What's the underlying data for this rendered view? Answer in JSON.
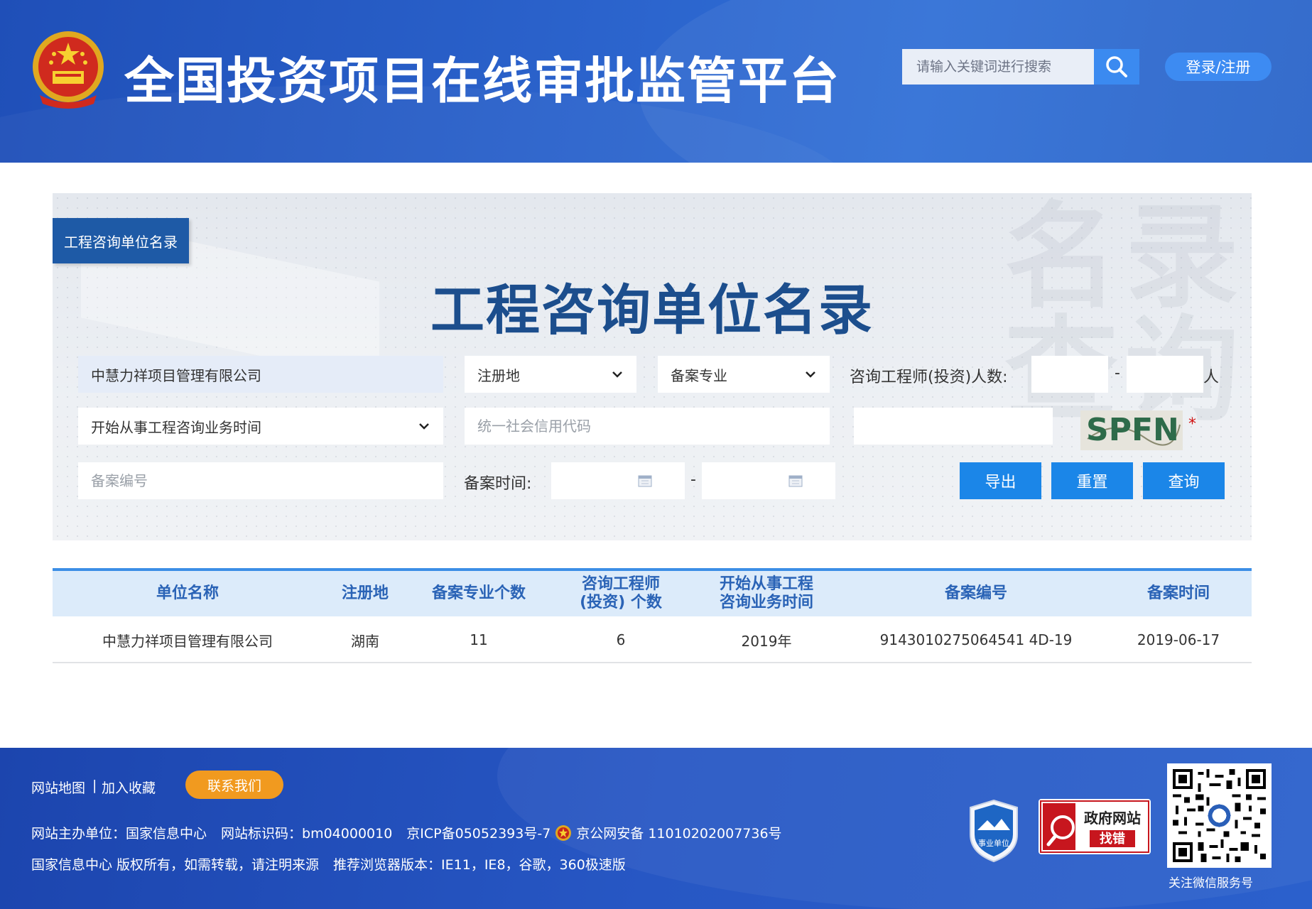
{
  "header": {
    "site_title": "全国投资项目在线审批监管平台",
    "search_placeholder": "请输入关键词进行搜索",
    "login_label": "登录/注册"
  },
  "panel": {
    "tag": "工程咨询单位名录",
    "title": "工程咨询单位名录",
    "watermark_line1": "名录",
    "watermark_line2": "查询",
    "unit_name_value": "中慧力祥项目管理有限公司",
    "region_select": "注册地",
    "specialty_select": "备案专业",
    "engineer_count_label": "咨询工程师(投资)人数:",
    "range_dash": "-",
    "people_unit": "人",
    "start_time_select": "开始从事工程咨询业务时间",
    "credit_code_placeholder": "统一社会信用代码",
    "captcha_text": "SPFN",
    "required_mark": "*",
    "record_no_placeholder": "备案编号",
    "record_time_label": "备案时间:",
    "export_label": "导出",
    "reset_label": "重置",
    "query_label": "查询"
  },
  "table": {
    "headers": [
      "单位名称",
      "注册地",
      "备案专业个数",
      "咨询工程师\n(投资) 个数",
      "开始从事工程\n咨询业务时间",
      "备案编号",
      "备案时间"
    ],
    "rows": [
      [
        "中慧力祥项目管理有限公司",
        "湖南",
        "11",
        "6",
        "2019年",
        "9143010275064541 4D-19",
        "2019-06-17"
      ]
    ]
  },
  "footer": {
    "sitemap": "网站地图",
    "sep": "|",
    "favorite": "加入收藏",
    "contact": "联系我们",
    "sponsor": "网站主办单位：国家信息中心",
    "site_id": "网站标识码：bm04000010",
    "icp": "京ICP备05052393号-7",
    "police": "京公网安备 11010202007736号",
    "copyright": "国家信息中心 版权所有，如需转载，请注明来源",
    "browser": "推荐浏览器版本：IE11，IE8，谷歌，360极速版",
    "badge_label": "事业单位",
    "gov_top": "政府网站",
    "gov_bottom": "找错",
    "qr_label": "关注微信服务号"
  },
  "colors": {
    "header_blue": "#2b63cc",
    "button_blue": "#1b86e8",
    "title_blue": "#1c4e8d",
    "contact_orange": "#f19a1f",
    "table_head_bg": "#dcebfa"
  }
}
